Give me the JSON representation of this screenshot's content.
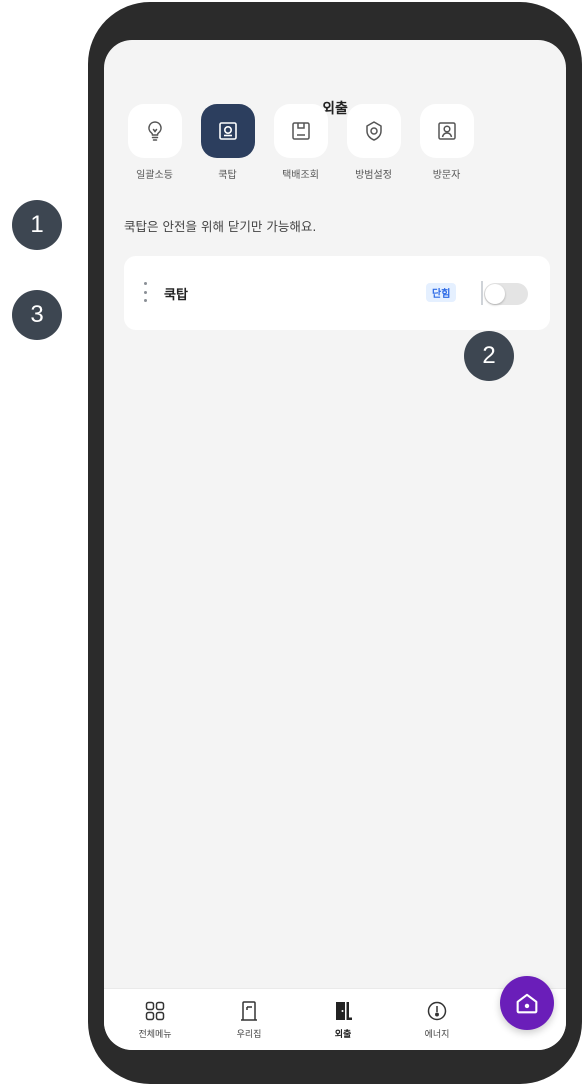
{
  "header": {
    "title": "외출"
  },
  "categories": [
    {
      "label": "일괄소등",
      "icon": "lightbulb-icon",
      "active": false
    },
    {
      "label": "쿡탑",
      "icon": "cooktop-icon",
      "active": true
    },
    {
      "label": "택배조회",
      "icon": "parcel-icon",
      "active": false
    },
    {
      "label": "방범설정",
      "icon": "security-shield-icon",
      "active": false
    },
    {
      "label": "방문자",
      "icon": "visitor-icon",
      "active": false
    }
  ],
  "notice": "쿡탑은 안전을 위해 닫기만 가능해요.",
  "device_card": {
    "name": "쿡탑",
    "badge": "단힘",
    "toggle_on": false
  },
  "bottom_nav": [
    {
      "label": "전체메뉴",
      "icon": "grid-menu-icon"
    },
    {
      "label": "우리집",
      "icon": "door-icon"
    },
    {
      "label": "외출",
      "icon": "exit-icon",
      "active": true
    },
    {
      "label": "에너지",
      "icon": "energy-gauge-icon"
    }
  ],
  "home_button": {
    "icon": "home-icon"
  },
  "step_markers": [
    "1",
    "2",
    "3"
  ],
  "colors": {
    "active_category": "#2c3e5e",
    "badge_text": "#2e6be6",
    "badge_bg": "#e5f0ff",
    "home_fab": "#6a1eb9",
    "marker": "#3d4651"
  }
}
